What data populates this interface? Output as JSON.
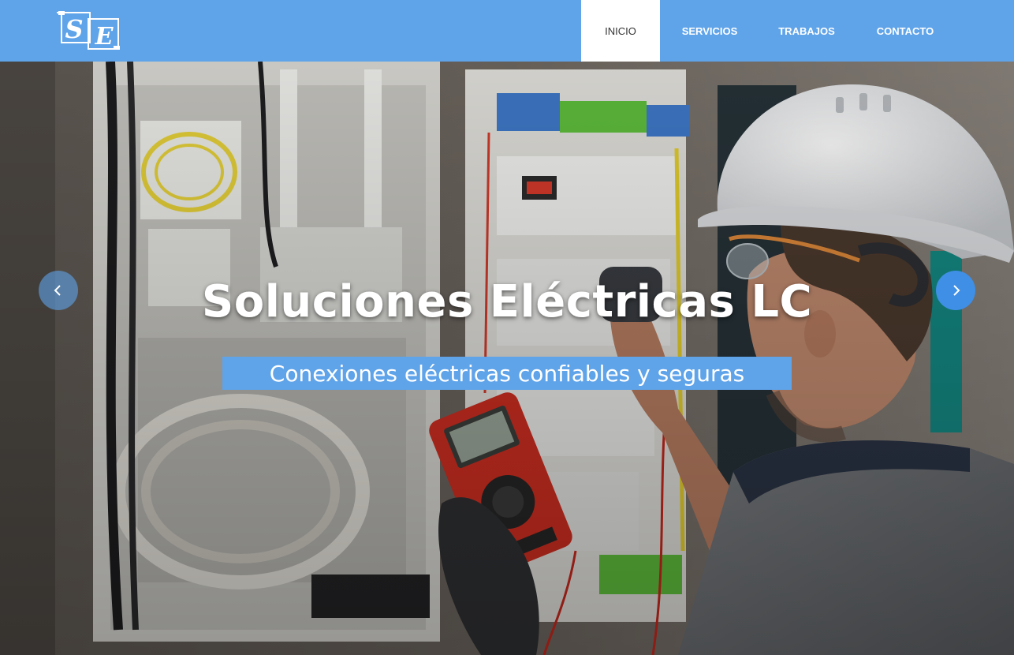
{
  "header": {
    "logo": {
      "text": "SE",
      "icon": "plug-logo-icon"
    },
    "nav": {
      "items": [
        {
          "label": "INICIO",
          "active": true
        },
        {
          "label": "SERVICIOS",
          "active": false
        },
        {
          "label": "TRABAJOS",
          "active": false
        },
        {
          "label": "CONTACTO",
          "active": false
        }
      ]
    }
  },
  "hero": {
    "title": "Soluciones Eléctricas LC",
    "subtitle": "Conexiones eléctricas confiables y seguras",
    "prev_icon": "chevron-left-icon",
    "next_icon": "chevron-right-icon"
  },
  "colors": {
    "brand": "#5fa3e9",
    "nav_active_bg": "#ffffff",
    "next_button": "#3f8fe6"
  }
}
